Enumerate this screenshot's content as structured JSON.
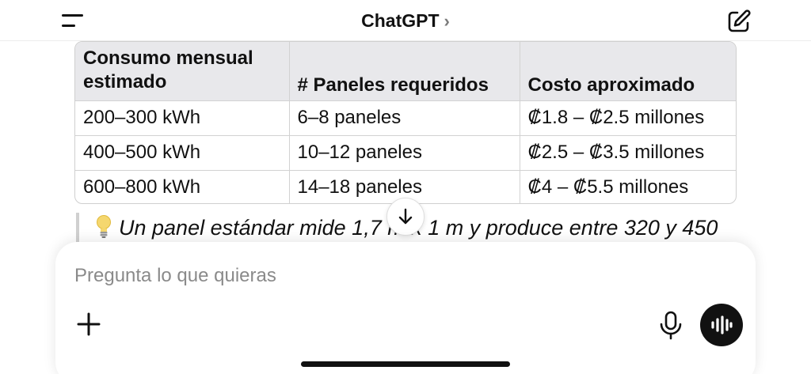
{
  "header": {
    "title": "ChatGPT",
    "chevron": "›",
    "menu_icon": "sidebar-menu-icon",
    "compose_icon": "new-chat-icon"
  },
  "table": {
    "headers": [
      [
        "Consumo mensual",
        "estimado"
      ],
      "# Paneles requeridos",
      "Costo aproximado"
    ],
    "rows": [
      [
        "200–300 kWh",
        "6–8 paneles",
        "₡1.8 – ₡2.5 millones"
      ],
      [
        "400–500 kWh",
        "10–12 paneles",
        "₡2.5 – ₡3.5 millones"
      ],
      [
        "600–800 kWh",
        "14–18 paneles",
        "₡4 – ₡5.5 millones"
      ]
    ]
  },
  "note": {
    "icon": "lightbulb-icon",
    "text": "Un panel estándar mide 1,7 m x 1 m y produce entre 320 y 450"
  },
  "scroll_button": {
    "icon": "arrow-down-icon"
  },
  "composer": {
    "placeholder": "Pregunta lo que quieras",
    "plus_icon": "plus-icon",
    "mic_icon": "microphone-icon",
    "voice_icon": "voice-mode-icon"
  },
  "colors": {
    "header_bg": "#e8e8eb",
    "border": "#d2d2d2",
    "text": "#111111",
    "placeholder": "#8a8a8a",
    "voice_button": "#111111"
  }
}
